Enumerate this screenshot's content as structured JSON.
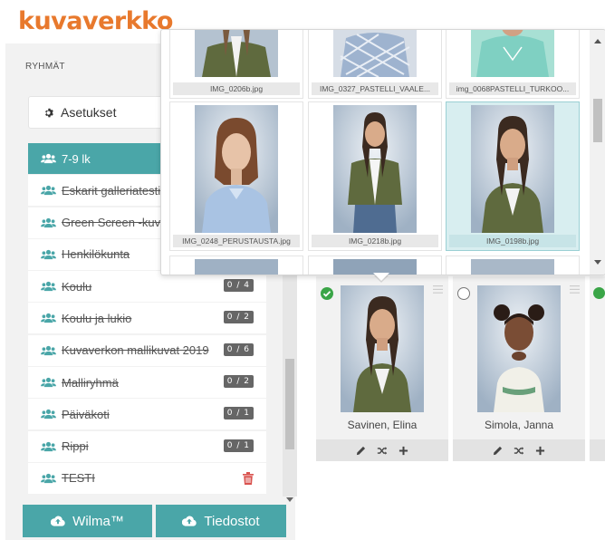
{
  "app": {
    "logo": "kuvaverkko",
    "brand_color": "#e8792d",
    "accent_color": "#4aa6a8"
  },
  "sidebar": {
    "heading": "RYHMÄT",
    "settings_label": "Asetukset",
    "groups": [
      {
        "label": "7-9 lk",
        "active": true,
        "badge": ""
      },
      {
        "label": "Eskarit galleriatesti",
        "badge": ""
      },
      {
        "label": "Green Screen -kuva",
        "badge": ""
      },
      {
        "label": "Henkilökunta",
        "badge": ""
      },
      {
        "label": "Koulu",
        "badge": "0 / 4"
      },
      {
        "label": "Koulu ja lukio",
        "badge": "0 / 2"
      },
      {
        "label": "Kuvaverkon mallikuvat 2019",
        "badge": "0 / 6"
      },
      {
        "label": "Malliryhmä",
        "badge": "0 / 2"
      },
      {
        "label": "Päiväkoti",
        "badge": "0 / 1"
      },
      {
        "label": "Rippi",
        "badge": "0 / 1"
      },
      {
        "label": "TESTI",
        "badge": "",
        "trash": true
      }
    ],
    "wilma_button": "Wilma™",
    "files_button": "Tiedostot"
  },
  "popup": {
    "top_row": [
      {
        "caption": "IMG_0206b.jpg"
      },
      {
        "caption": "IMG_0327_PASTELLI_VAALE..."
      },
      {
        "caption": "img_0068PASTELLI_TURKOO..."
      }
    ],
    "middle_row": [
      {
        "caption": "IMG_0248_PERUSTAUSTA.jpg"
      },
      {
        "caption": "IMG_0218b.jpg"
      },
      {
        "caption": "IMG_0198b.jpg",
        "selected": true
      }
    ]
  },
  "cards": [
    {
      "name": "Savinen, Elina",
      "checked": true
    },
    {
      "name": "Simola, Janna",
      "checked": false
    }
  ]
}
